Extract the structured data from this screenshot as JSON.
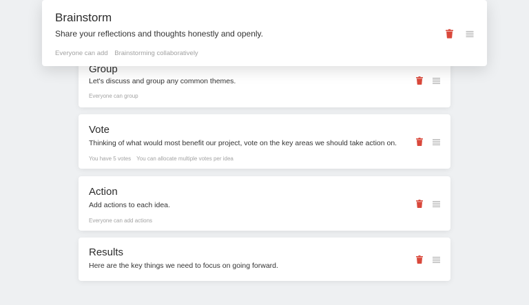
{
  "featured": {
    "title": "Brainstorm",
    "description": "Share your reflections and thoughts honestly and openly.",
    "meta": [
      "Everyone can add",
      "Brainstorming collaboratively"
    ]
  },
  "stages": [
    {
      "title": "Group",
      "description": "Let's discuss and group any common themes.",
      "meta": [
        "Everyone can group"
      ]
    },
    {
      "title": "Vote",
      "description": "Thinking of what would most benefit our project, vote on the key areas we should take action on.",
      "meta": [
        "You have 5 votes",
        "You can allocate multiple votes per idea"
      ]
    },
    {
      "title": "Action",
      "description": "Add actions to each idea.",
      "meta": [
        "Everyone can add actions"
      ]
    },
    {
      "title": "Results",
      "description": "Here are the key things we need to focus on going forward.",
      "meta": []
    }
  ],
  "colors": {
    "accent_delete": "#d9483b",
    "drag_handle": "#b3b3b3",
    "background": "#eef0f2"
  },
  "icons": {
    "delete": "trash-icon",
    "reorder": "drag-handle-icon"
  }
}
